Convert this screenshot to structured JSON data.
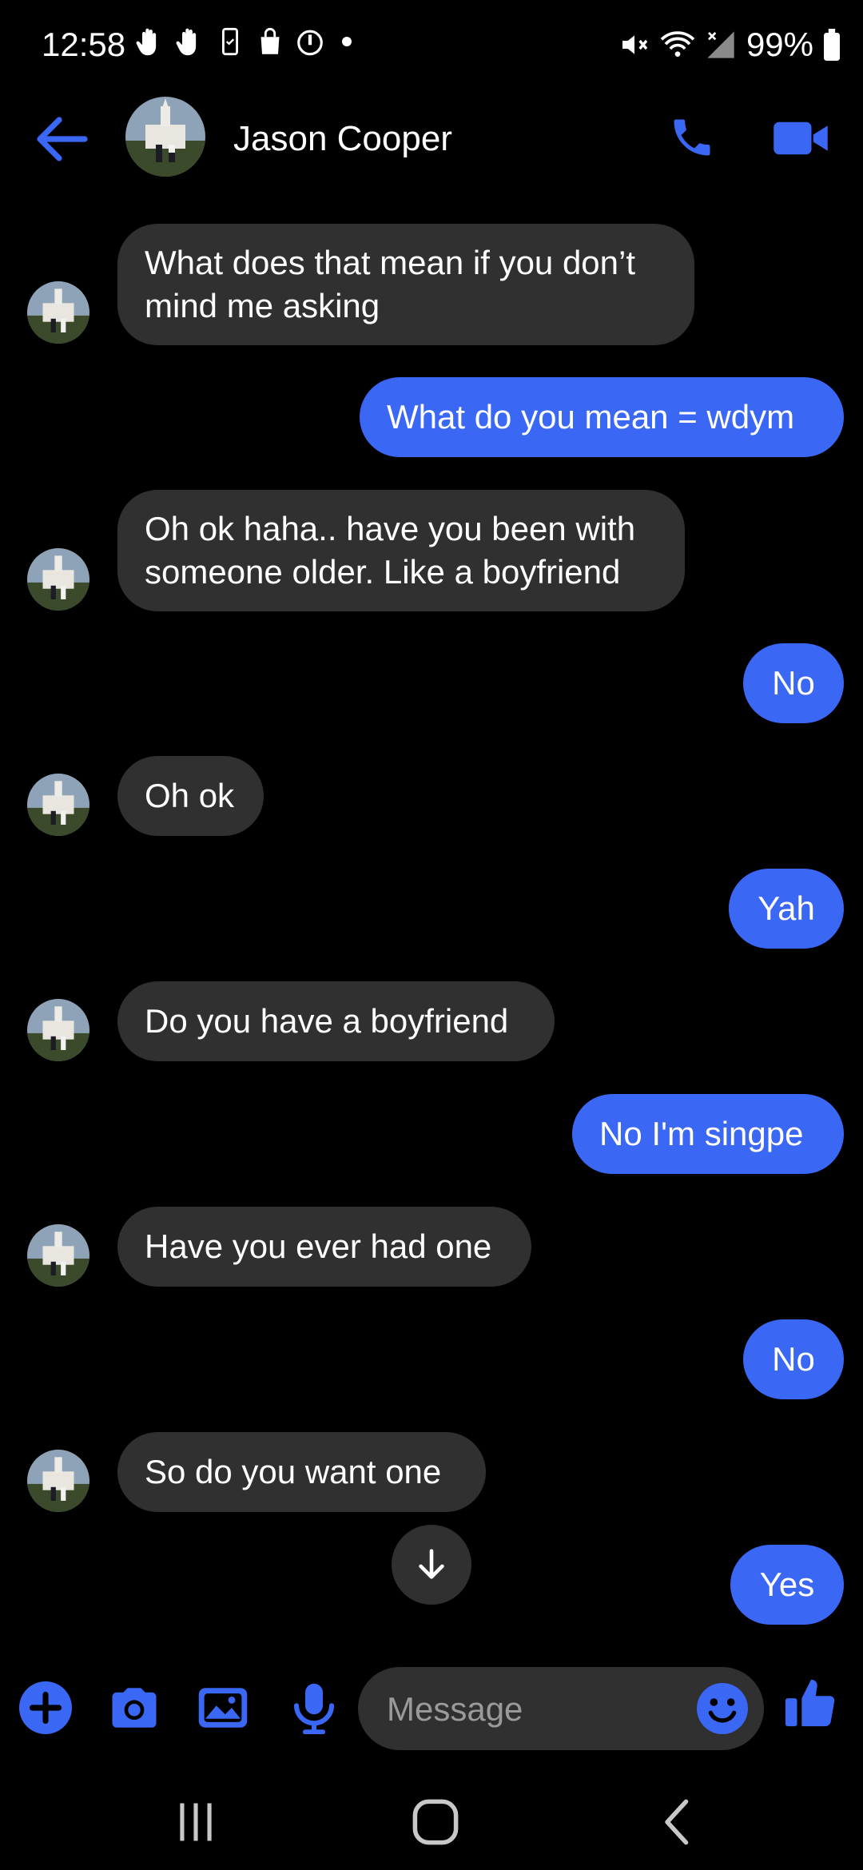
{
  "status": {
    "time": "12:58",
    "battery": "99%"
  },
  "header": {
    "contact_name": "Jason Cooper"
  },
  "messages": [
    {
      "dir": "in",
      "lines": [
        "What does that mean if you don’t",
        "mind me asking"
      ]
    },
    {
      "dir": "out",
      "text": "What do you mean = wdym"
    },
    {
      "dir": "in",
      "lines": [
        "Oh ok haha.. have you been with",
        "someone older. Like a boyfriend"
      ]
    },
    {
      "dir": "out",
      "text": "No"
    },
    {
      "dir": "in",
      "text": "Oh ok"
    },
    {
      "dir": "out",
      "text": "Yah"
    },
    {
      "dir": "in",
      "text": "Do you have a boyfriend"
    },
    {
      "dir": "out",
      "text": "No I'm singpe"
    },
    {
      "dir": "in",
      "text": "Have you ever had one"
    },
    {
      "dir": "out",
      "text": "No"
    },
    {
      "dir": "in",
      "text": "So do you want one"
    },
    {
      "dir": "out",
      "text": "Yes"
    }
  ],
  "composer": {
    "placeholder": "Message"
  },
  "colors": {
    "accent": "#3b67f5",
    "bubble_in": "#303030",
    "background": "#000000"
  },
  "icons": [
    "back-arrow-icon",
    "phone-icon",
    "video-camera-icon",
    "plus-icon",
    "camera-icon",
    "image-icon",
    "microphone-icon",
    "emoji-icon",
    "thumbs-up-icon",
    "arrow-down-icon"
  ]
}
